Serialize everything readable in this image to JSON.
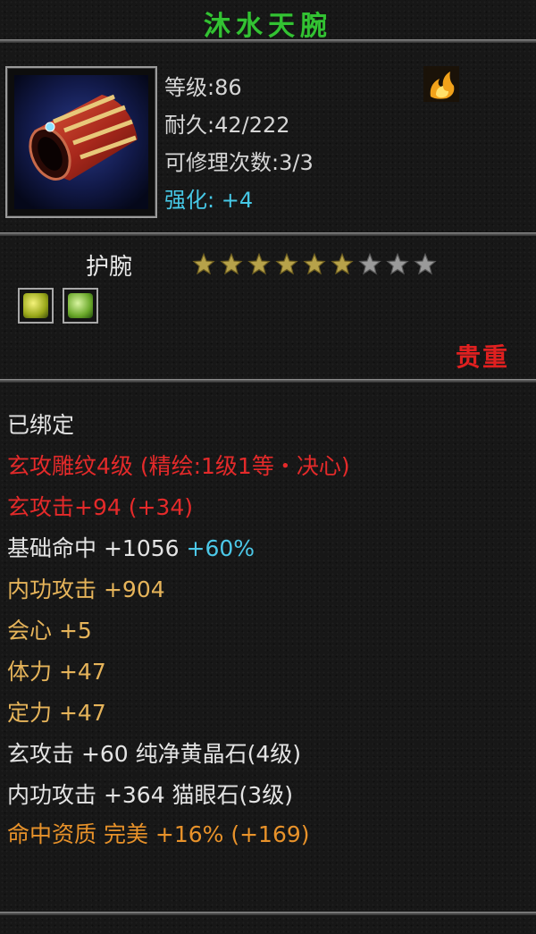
{
  "title": "沐水天腕",
  "colors": {
    "title": "#33c233",
    "stat": "#d6d6d6",
    "enhance": "#46c8e6",
    "rarity": "#e02020",
    "red_line": "#e42a2a",
    "gold_line": "#e6b45a",
    "orange_line": "#e8922a",
    "bonus_cyan": "#4cc8e8"
  },
  "item": {
    "icon": "bracer-icon",
    "level": "等级:86",
    "durability": "耐久:42/222",
    "repairs": "可修理次数:3/3",
    "enhance": "强化: +4",
    "badge_icon": "flame-icon"
  },
  "type": {
    "label": "护腕",
    "stars_filled": 6,
    "stars_total": 9
  },
  "gems": [
    "yellow-gem-icon",
    "green-gem-icon"
  ],
  "rarity": "贵重",
  "attributes": {
    "bound": "已绑定",
    "engrave": "玄攻雕纹4级 (精绘:1级1等・决心)",
    "xuan_attack_name": "玄攻击",
    "xuan_attack_value": "+94 (+34)",
    "hit_name": "基础命中",
    "hit_value": "+1056",
    "hit_bonus": "+60%",
    "inner_attack_name": "内功攻击",
    "inner_attack_value": "+904",
    "crit_name": "会心",
    "crit_value": "+5",
    "stamina_name": "体力",
    "stamina_value": "+47",
    "focus_name": "定力",
    "focus_value": "+47",
    "gem1": "玄攻击 +60 纯净黄晶石(4级)",
    "gem2": "内功攻击 +364 猫眼石(3级)",
    "aptitude": "命中资质  完美 +16% (+169)"
  }
}
